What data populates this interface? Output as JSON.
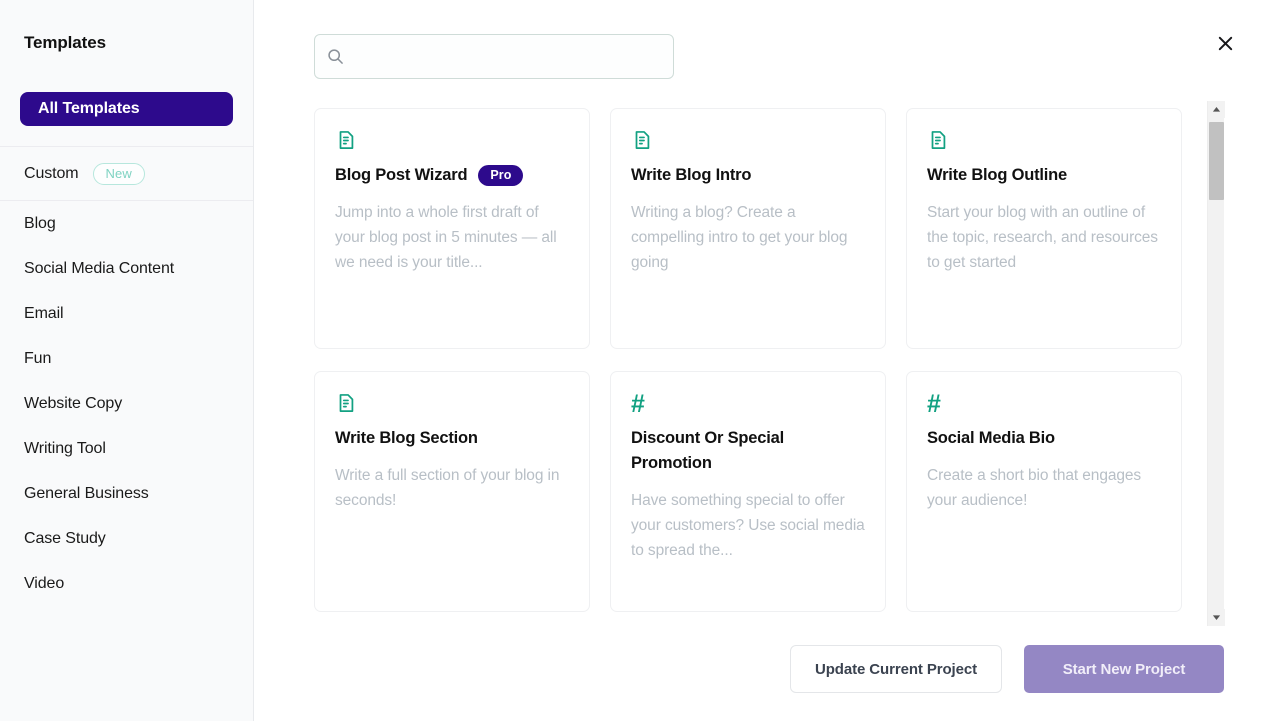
{
  "sidebar": {
    "title": "Templates",
    "all_templates_label": "All Templates",
    "custom": {
      "label": "Custom",
      "badge": "New"
    },
    "items": [
      {
        "label": "Blog"
      },
      {
        "label": "Social Media Content"
      },
      {
        "label": "Email"
      },
      {
        "label": "Fun"
      },
      {
        "label": "Website Copy"
      },
      {
        "label": "Writing Tool"
      },
      {
        "label": "General Business"
      },
      {
        "label": "Case Study"
      },
      {
        "label": "Video"
      }
    ]
  },
  "search": {
    "value": "",
    "placeholder": "",
    "icon": "search-icon"
  },
  "close": {
    "icon": "close-icon"
  },
  "templates": [
    {
      "icon": "document-icon",
      "title": "Blog Post Wizard",
      "badge": "Pro",
      "description": "Jump into a whole first draft of your blog post in 5 minutes — all we need is your title..."
    },
    {
      "icon": "document-icon",
      "title": "Write Blog Intro",
      "badge": "",
      "description": "Writing a blog? Create a compelling intro to get your blog going"
    },
    {
      "icon": "document-icon",
      "title": "Write Blog Outline",
      "badge": "",
      "description": "Start your blog with an outline of the topic, research, and resources to get started"
    },
    {
      "icon": "document-icon",
      "title": "Write Blog Section",
      "badge": "",
      "description": "Write a full section of your blog in seconds!"
    },
    {
      "icon": "hashtag-icon",
      "title": "Discount Or Special Promotion",
      "badge": "",
      "description": "Have something special to offer your customers? Use social media to spread the..."
    },
    {
      "icon": "hashtag-icon",
      "title": "Social Media Bio",
      "badge": "",
      "description": "Create a short bio that engages your audience!"
    }
  ],
  "footer": {
    "update_label": "Update Current Project",
    "start_label": "Start New Project"
  },
  "colors": {
    "accent_purple": "#2d0a8c",
    "primary_button": "#9487c4",
    "icon_teal": "#12a182",
    "badge_new_border": "#b7e7dd",
    "muted_text": "#b8bfc6"
  }
}
